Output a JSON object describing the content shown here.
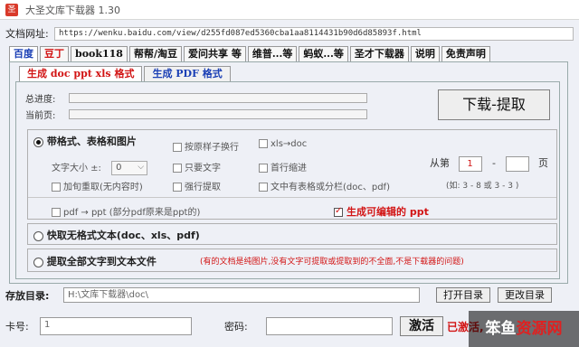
{
  "window": {
    "title": "大圣文库下载器 1.30"
  },
  "url": {
    "label": "文档网址:",
    "value": "https://wenku.baidu.com/view/d255fd087ed5360cba1aa8114431b90d6d85893f.html"
  },
  "tabs": [
    {
      "label": "百度",
      "active": true
    },
    {
      "label": "豆丁",
      "red": true
    },
    {
      "label": "book118"
    },
    {
      "label": "帮帮/淘豆"
    },
    {
      "label": "爱问共享 等"
    },
    {
      "label": "维普...等"
    },
    {
      "label": "蚂蚁...等"
    },
    {
      "label": "圣才下载器"
    },
    {
      "label": "说明"
    },
    {
      "label": "免责声明"
    }
  ],
  "subtabs": {
    "doc": "生成 doc ppt xls 格式",
    "pdf": "生成 PDF 格式"
  },
  "progress": {
    "total_label": "总进度:",
    "current_label": "当前页:",
    "total": 0,
    "current": 0
  },
  "download_button": "下载-提取",
  "mode1": {
    "label": "带格式、表格和图片",
    "font_size_label": "文字大小 ±:",
    "font_size_value": "0",
    "opt_keep_newline": "按原样子换行",
    "opt_text_only": "只要文字",
    "opt_force_extract": "强行提取",
    "opt_xls_doc": "xls→doc",
    "opt_first_indent": "首行缩进",
    "opt_table_columns": "文中有表格或分栏(doc、pdf)",
    "opt_reload": "加旬重取(无内容时)",
    "page_from_label": "从第",
    "page_from": "1",
    "page_dash": "-",
    "page_to": "",
    "page_unit": "页",
    "page_example": "(如: 3 - 8  或 3 - 3 )",
    "pdf_to_ppt": "pdf → ppt (部分pdf原来是ppt的)",
    "editable_ppt": "生成可编辑的 ppt"
  },
  "mode2": {
    "label": "快取无格式文本(doc、xls、pdf)"
  },
  "mode3": {
    "label": "提取全部文字到文本文件",
    "note": "(有的文档是纯图片,没有文字可提取或提取到的不全面,不是下载器的问题)"
  },
  "dir": {
    "label": "存放目录:",
    "value": "H:\\文库下载器\\doc\\",
    "open_button": "打开目录",
    "change_button": "更改目录"
  },
  "card": {
    "label": "卡号:",
    "value": "1",
    "password_label": "密码:",
    "password_value": "",
    "activate_button": "激活",
    "status": "已激活,"
  },
  "watermark": {
    "part1": "笨鱼",
    "part2": "资源网"
  },
  "colors": {
    "accent_red": "#d21414",
    "accent_blue": "#1a3fb5"
  }
}
